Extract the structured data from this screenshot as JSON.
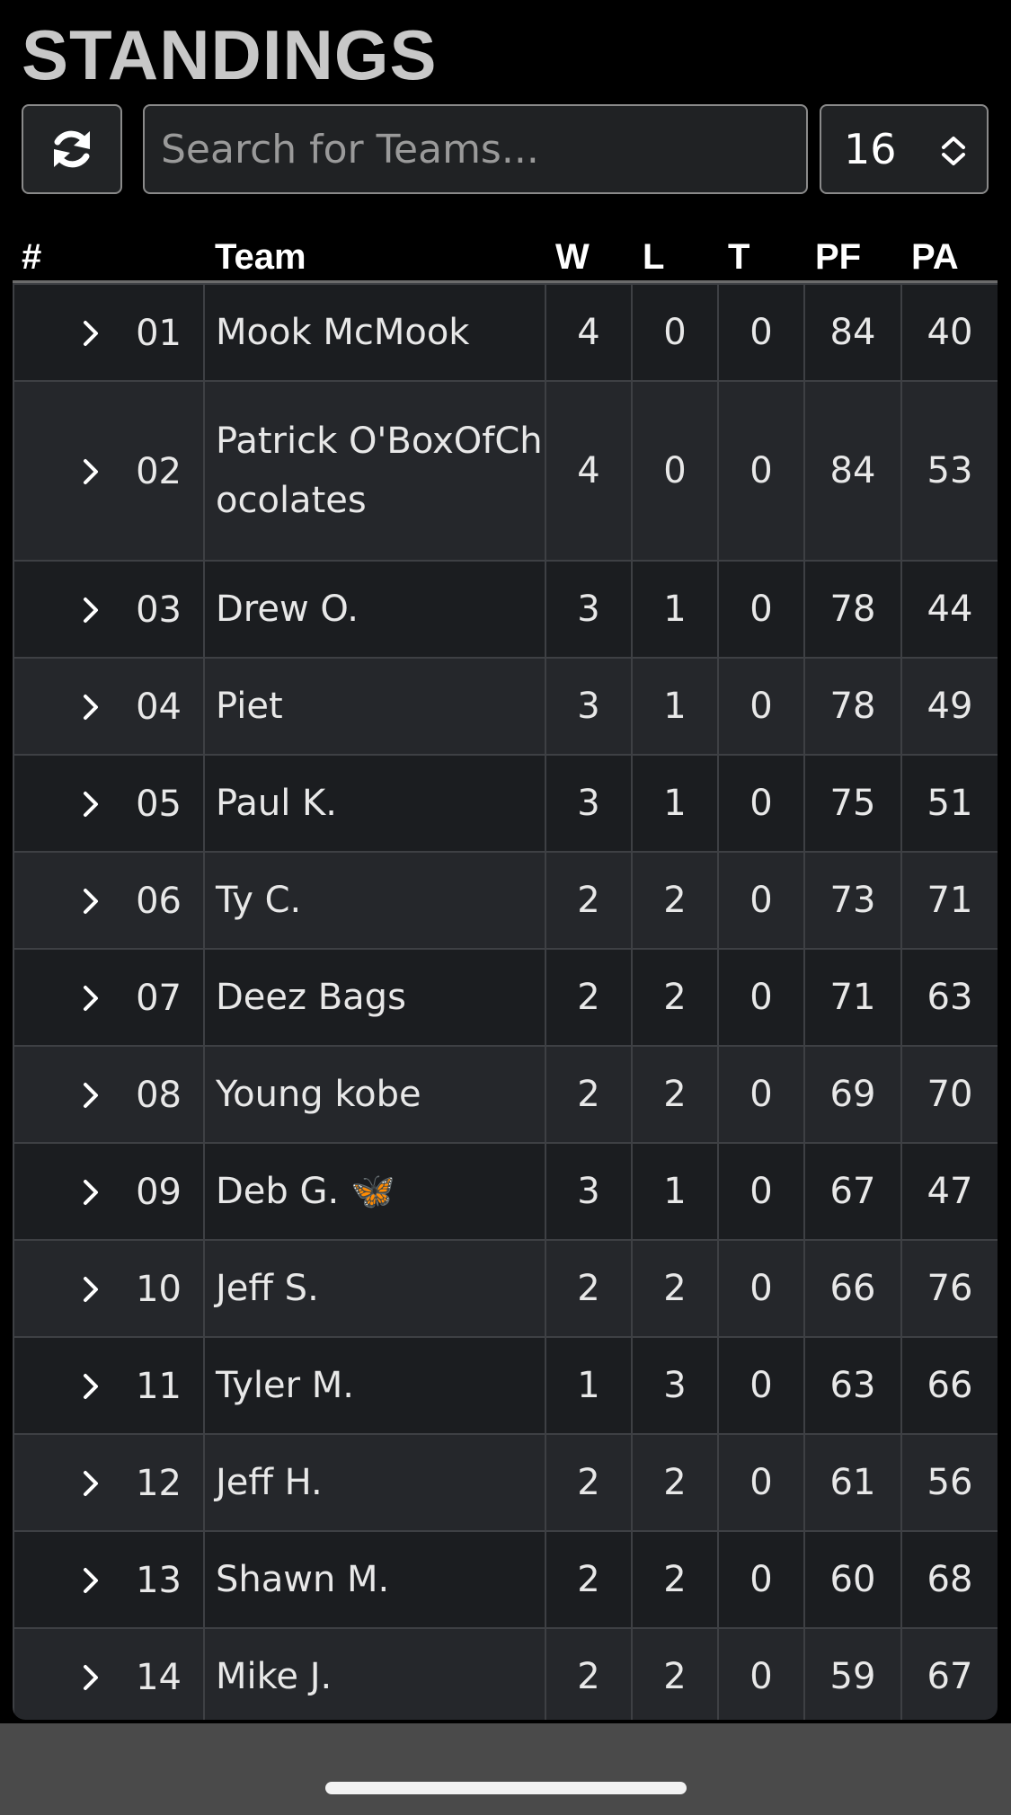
{
  "header": {
    "title": "STANDINGS"
  },
  "controls": {
    "refresh_icon": "refresh-icon",
    "search_placeholder": "Search for Teams...",
    "week_select_value": "16"
  },
  "columns": {
    "rank": "#",
    "team": "Team",
    "w": "W",
    "l": "L",
    "t": "T",
    "pf": "PF",
    "pa": "PA"
  },
  "rows": [
    {
      "rank": "01",
      "team": "Mook McMook",
      "w": "4",
      "l": "0",
      "t": "0",
      "pf": "84",
      "pa": "40"
    },
    {
      "rank": "02",
      "team": "Patrick O'BoxOfChocolates",
      "w": "4",
      "l": "0",
      "t": "0",
      "pf": "84",
      "pa": "53"
    },
    {
      "rank": "03",
      "team": "Drew O.",
      "w": "3",
      "l": "1",
      "t": "0",
      "pf": "78",
      "pa": "44"
    },
    {
      "rank": "04",
      "team": "Piet",
      "w": "3",
      "l": "1",
      "t": "0",
      "pf": "78",
      "pa": "49"
    },
    {
      "rank": "05",
      "team": "Paul K.",
      "w": "3",
      "l": "1",
      "t": "0",
      "pf": "75",
      "pa": "51"
    },
    {
      "rank": "06",
      "team": "Ty C.",
      "w": "2",
      "l": "2",
      "t": "0",
      "pf": "73",
      "pa": "71"
    },
    {
      "rank": "07",
      "team": "Deez Bags",
      "w": "2",
      "l": "2",
      "t": "0",
      "pf": "71",
      "pa": "63"
    },
    {
      "rank": "08",
      "team": "Young kobe",
      "w": "2",
      "l": "2",
      "t": "0",
      "pf": "69",
      "pa": "70"
    },
    {
      "rank": "09",
      "team": "Deb G. 🦋",
      "w": "3",
      "l": "1",
      "t": "0",
      "pf": "67",
      "pa": "47"
    },
    {
      "rank": "10",
      "team": "Jeff S.",
      "w": "2",
      "l": "2",
      "t": "0",
      "pf": "66",
      "pa": "76"
    },
    {
      "rank": "11",
      "team": "Tyler M.",
      "w": "1",
      "l": "3",
      "t": "0",
      "pf": "63",
      "pa": "66"
    },
    {
      "rank": "12",
      "team": "Jeff H.",
      "w": "2",
      "l": "2",
      "t": "0",
      "pf": "61",
      "pa": "56"
    },
    {
      "rank": "13",
      "team": "Shawn M.",
      "w": "2",
      "l": "2",
      "t": "0",
      "pf": "60",
      "pa": "68"
    },
    {
      "rank": "14",
      "team": "Mike J.",
      "w": "2",
      "l": "2",
      "t": "0",
      "pf": "59",
      "pa": "67"
    }
  ],
  "colors": {
    "background": "#000000",
    "row_odd": "#1b1d20",
    "row_even": "#25272b",
    "title": "#c8c8c8"
  }
}
